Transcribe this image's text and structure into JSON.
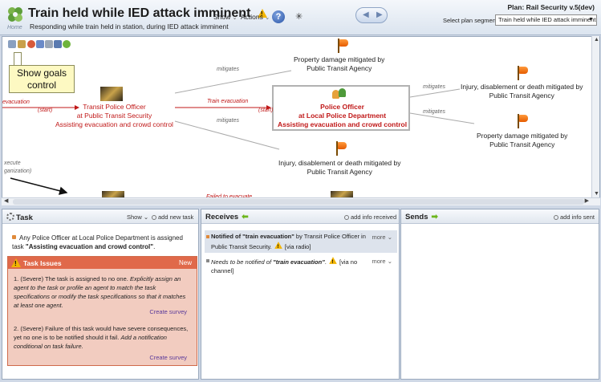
{
  "header": {
    "home_label": "Home",
    "title": "Train held while IED attack imminent",
    "subtitle": "Responding while train held in station, during IED attack imminent",
    "show_menu": "Show",
    "actions_menu": "Actions",
    "plan_label": "Plan: Rail Security v.5(dev)",
    "segment_label": "Select plan segment:",
    "segment_value": "Train held while IED attack imminent"
  },
  "diagram": {
    "callout": "Show goals control",
    "nodes": {
      "property_top": [
        "Property damage mitigated by",
        "Public Transit Agency"
      ],
      "transit_officer": [
        "Transit Police Officer",
        "at Public Transit Security",
        "Assisting evacuation and crowd control"
      ],
      "police_officer": [
        "Police Officer",
        "at Local Police Department",
        "Assisting evacuation and crowd control"
      ],
      "injury_bottom": [
        "Injury, disablement or death mitigated by",
        "Public Transit Agency"
      ],
      "injury_right": [
        "Injury, disablement or death mitigated by",
        "Public Transit Agency"
      ],
      "property_right": [
        "Property damage mitigated by",
        "Public Transit Agency"
      ]
    },
    "edges": {
      "mitigates_1": "mitigates",
      "mitigates_2": "mitigates",
      "mitigates_3": "mitigates",
      "mitigates_4": "mitigates",
      "train_evacuation": "Train evacuation",
      "start_left": "(start)",
      "start_mid": "(start)",
      "evacuation_left": "evacuation",
      "execute_left": "xecute",
      "organization_left": "ganization)",
      "failed_evacuate": "Failed to evacuate"
    }
  },
  "task_panel": {
    "title": "Task",
    "show_menu": "Show",
    "add_new": "add new task",
    "sentence_prefix": "Any Police Officer at Local Police Department is assigned task",
    "sentence_task": "\"Assisting evacuation and crowd control\"",
    "sentence_end": ".",
    "issues_title": "Task Issues",
    "issues_new": "New",
    "issue1_prefix": "1. (Severe) The task is assigned to no one.",
    "issue1_italic": "Explicitly assign an agent to the task or profile an agent to match the task specifications or modify the task specifications so that it matches at least one agent.",
    "issue2_prefix": "2. (Severe) Failure of this task would have severe consequences, yet no one is to be notified should it fail.",
    "issue2_italic": "Add a notification conditional on task failure.",
    "create_survey_1": "Create survey",
    "create_survey_2": "Create survey"
  },
  "receives_panel": {
    "title": "Receives",
    "add_info": "add info received",
    "item1_a": "Notified of ",
    "item1_b": "\"train evacuation\"",
    "item1_c": " by Transit Police Officer in Public Transit Security.",
    "item1_d": " [via radio]",
    "item2_a": "Needs to be notified of ",
    "item2_b": "\"train evacuation\"",
    "item2_c": ".",
    "item2_d": " [via no channel]",
    "more": "more"
  },
  "sends_panel": {
    "title": "Sends",
    "add_info": "add info sent"
  },
  "colors": {
    "accent_red": "#c01818",
    "issue_header": "#e0694a",
    "issue_bg": "#f2ccc0",
    "green_arrow": "#6cb61c"
  }
}
